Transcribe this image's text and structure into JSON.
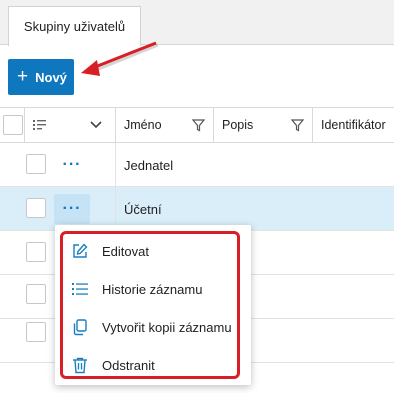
{
  "tabs": [
    {
      "label": "Skupiny uživatelů",
      "active": true
    }
  ],
  "toolbar": {
    "new_label": "Nový",
    "new_icon": "plus-icon"
  },
  "grid": {
    "columns": [
      {
        "label": ""
      },
      {
        "label": "Jméno"
      },
      {
        "label": "Popis"
      },
      {
        "label": "Identifikátor"
      }
    ],
    "rows": [
      {
        "name": "Jednatel",
        "selected": false
      },
      {
        "name": "Účetní",
        "selected": true
      },
      {
        "name": "",
        "selected": false
      },
      {
        "name": "",
        "selected": false
      },
      {
        "name": "",
        "selected": false
      }
    ]
  },
  "context_menu": {
    "items": [
      {
        "label": "Editovat",
        "icon": "edit-icon"
      },
      {
        "label": "Historie záznamu",
        "icon": "list-icon"
      },
      {
        "label": "Vytvořit kopii záznamu",
        "icon": "copy-icon"
      },
      {
        "label": "Odstranit",
        "icon": "trash-icon"
      }
    ]
  },
  "colors": {
    "accent": "#0f77bd",
    "selected_row": "#d9eef9",
    "annotation": "#d81f26"
  }
}
